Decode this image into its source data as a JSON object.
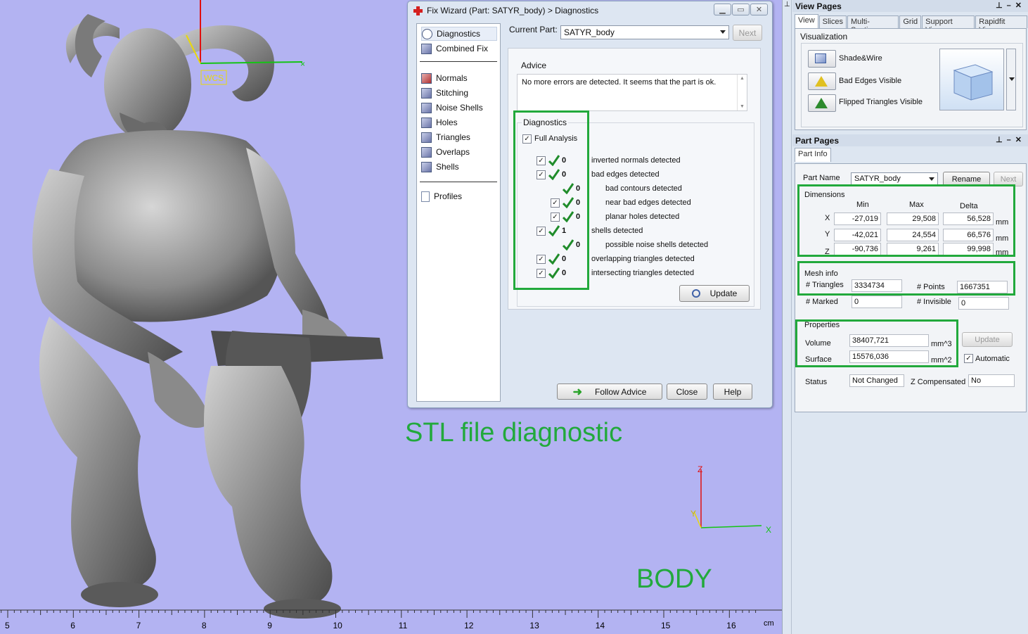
{
  "viewport": {
    "caption_main": "STL file diagnostic",
    "caption_part": "BODY",
    "wcs_label": "WCS",
    "axis_labels": {
      "x": "X",
      "y": "Y",
      "z": "Z"
    },
    "ruler": {
      "ticks": [
        "5",
        "6",
        "7",
        "8",
        "9",
        "10",
        "11",
        "12",
        "13",
        "14",
        "15",
        "16"
      ],
      "unit": "cm"
    }
  },
  "fix_wizard": {
    "title": "Fix Wizard (Part: SATYR_body) > Diagnostics",
    "nav": [
      {
        "label": "Diagnostics"
      },
      {
        "label": "Combined Fix"
      },
      {
        "label": "Normals"
      },
      {
        "label": "Stitching"
      },
      {
        "label": "Noise Shells"
      },
      {
        "label": "Holes"
      },
      {
        "label": "Triangles"
      },
      {
        "label": "Overlaps"
      },
      {
        "label": "Shells"
      },
      {
        "label": "Profiles"
      }
    ],
    "current_part_label": "Current Part:",
    "current_part_value": "SATYR_body",
    "next_label": "Next",
    "advice_title": "Advice",
    "advice_text": "No more errors are detected. It seems that the part is ok.",
    "diagnostics_title": "Diagnostics",
    "full_analysis_label": "Full Analysis",
    "rows": [
      {
        "count": "0",
        "text": "inverted normals detected"
      },
      {
        "count": "0",
        "text": "bad edges detected"
      },
      {
        "count": "0",
        "text": "bad contours detected"
      },
      {
        "count": "0",
        "text": "near bad edges detected"
      },
      {
        "count": "0",
        "text": "planar holes detected"
      },
      {
        "count": "1",
        "text": "shells detected"
      },
      {
        "count": "0",
        "text": "possible noise shells detected"
      },
      {
        "count": "0",
        "text": "overlapping triangles detected"
      },
      {
        "count": "0",
        "text": "intersecting triangles detected"
      }
    ],
    "update_label": "Update",
    "follow_advice_label": "Follow Advice",
    "close_label": "Close",
    "help_label": "Help"
  },
  "view_pages": {
    "title": "View Pages",
    "tabs": [
      "View",
      "Slices",
      "Multi-Section",
      "Grid",
      "Support View",
      "Rapidfit View"
    ],
    "visualization_title": "Visualization",
    "items": [
      "Shade&Wire",
      "Bad Edges Visible",
      "Flipped Triangles Visible"
    ]
  },
  "part_pages": {
    "title": "Part Pages",
    "tab": "Part Info",
    "part_name_label": "Part Name",
    "part_name_value": "SATYR_body",
    "rename_label": "Rename",
    "next_label": "Next",
    "dimensions": {
      "title": "Dimensions",
      "headers": [
        "Min",
        "Max",
        "Delta"
      ],
      "rows": [
        {
          "axis": "X",
          "min": "-27,019",
          "max": "29,508",
          "delta": "56,528",
          "unit": "mm"
        },
        {
          "axis": "Y",
          "min": "-42,021",
          "max": "24,554",
          "delta": "66,576",
          "unit": "mm"
        },
        {
          "axis": "Z",
          "min": "-90,736",
          "max": "9,261",
          "delta": "99,998",
          "unit": "mm"
        }
      ]
    },
    "mesh_info": {
      "title": "Mesh info",
      "triangles_label": "# Triangles",
      "triangles": "3334734",
      "points_label": "# Points",
      "points": "1667351",
      "marked_label": "# Marked",
      "marked": "0",
      "invisible_label": "# Invisible",
      "invisible": "0"
    },
    "properties": {
      "title": "Properties",
      "volume_label": "Volume",
      "volume": "38407,721",
      "volume_unit": "mm^3",
      "surface_label": "Surface",
      "surface": "15576,036",
      "surface_unit": "mm^2",
      "update_label": "Update",
      "automatic_label": "Automatic"
    },
    "status_label": "Status",
    "status_value": "Not Changed",
    "zcomp_label": "Z Compensated",
    "zcomp_value": "No"
  },
  "colors": {
    "highlight_green": "#22a93c",
    "viewport_bg": "#b3b3f2"
  }
}
